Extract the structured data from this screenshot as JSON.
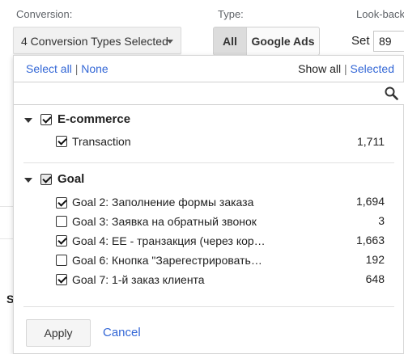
{
  "toolbar": {
    "conversion_label": "Conversion:",
    "conversion_value": "4 Conversion Types Selected",
    "type_label": "Type:",
    "type_options": [
      "All",
      "Google Ads"
    ],
    "lookback_label": "Look-back",
    "set_label": "Set",
    "set_value": "89"
  },
  "panel": {
    "select_all": "Select all",
    "separator": "|",
    "none": "None",
    "show_all": "Show all",
    "selected": "Selected",
    "search_value": "",
    "groups": [
      {
        "title": "E-commerce",
        "checked": true,
        "items": [
          {
            "label": "Transaction",
            "count": "1,711",
            "checked": true
          }
        ]
      },
      {
        "title": "Goal",
        "checked": "partial",
        "items": [
          {
            "label": "Goal 2: Заполнение формы заказа",
            "count": "1,694",
            "checked": true
          },
          {
            "label": "Goal 3: Заявка на обратный звонок",
            "count": "3",
            "checked": false
          },
          {
            "label": "Goal 4: EE - транзакция (через кор…",
            "count": "1,663",
            "checked": true
          },
          {
            "label": "Goal 6: Кнопка \"Зарегестрировать…",
            "count": "192",
            "checked": false
          },
          {
            "label": "Goal 7: 1-й заказ клиента",
            "count": "648",
            "checked": true
          }
        ]
      }
    ],
    "apply": "Apply",
    "cancel": "Cancel"
  },
  "background": {
    "partial_letter": "S"
  },
  "colors": {
    "link": "#3367d6",
    "button_bg": "#f1f1f1",
    "selected_segment": "#dcdcdc"
  }
}
